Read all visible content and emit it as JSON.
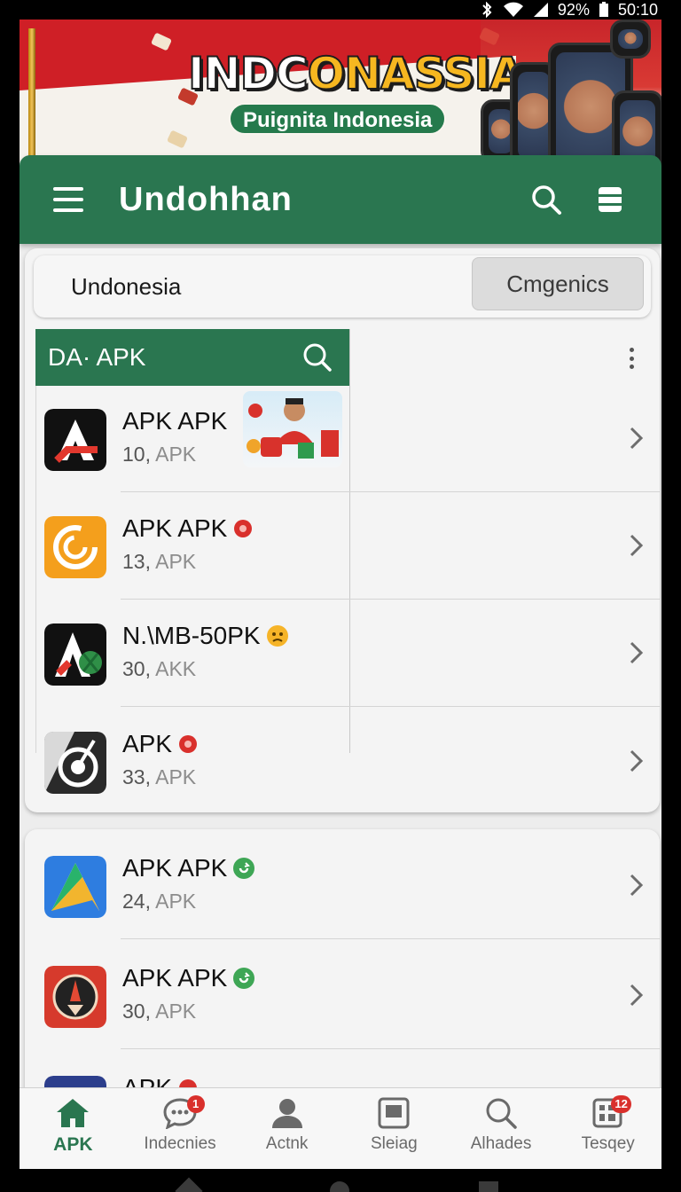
{
  "status_bar": {
    "battery": "92%",
    "time": "50:10"
  },
  "banner": {
    "title_part1": "INDC",
    "title_part2": "ONASSIA",
    "subtitle": "Puignita Indonesia"
  },
  "app_bar": {
    "title": "Undohhan"
  },
  "filter": {
    "label": "Undonesia",
    "button": "Cmgenics"
  },
  "sub_header": {
    "title": "DA· APK"
  },
  "card1_rows": [
    {
      "name": "APK APK",
      "count": "10,",
      "unit": "APK",
      "icon": "red-a-logo-icon",
      "badge": "balloon-icon"
    },
    {
      "name": "APK APK",
      "count": "13,",
      "unit": "APK",
      "icon": "orange-spiral-icon",
      "badge": "red-flower-icon"
    },
    {
      "name": "N.\\MB-50PK",
      "count": "30,",
      "unit": "AKK",
      "icon": "red-a-palm-icon",
      "badge": "angry-emoji-icon"
    },
    {
      "name": "APK",
      "count": "33,",
      "unit": "APK",
      "icon": "target-dial-icon",
      "badge": "red-flower-icon"
    }
  ],
  "card2_rows": [
    {
      "name": "APK APK",
      "count": "24,",
      "unit": "APK",
      "icon": "play-triangle-icon",
      "badge": "green-refresh-icon"
    },
    {
      "name": "APK APK",
      "count": "30,",
      "unit": "APK",
      "icon": "red-compass-icon",
      "badge": "green-refresh-icon"
    },
    {
      "name": "APK",
      "count": "",
      "unit": "",
      "icon": "blue-gear-icon",
      "badge": "red-flower-icon"
    }
  ],
  "bottom_nav": [
    {
      "label": "APK",
      "icon": "home-icon",
      "active": true,
      "badge": ""
    },
    {
      "label": "Indecnies",
      "icon": "chat-bubble-icon",
      "active": false,
      "badge": "1"
    },
    {
      "label": "Actnk",
      "icon": "person-icon",
      "active": false,
      "badge": ""
    },
    {
      "label": "Sleiag",
      "icon": "tablet-icon",
      "active": false,
      "badge": ""
    },
    {
      "label": "Alhades",
      "icon": "search-icon",
      "active": false,
      "badge": ""
    },
    {
      "label": "Tesqey",
      "icon": "grid-icon",
      "active": false,
      "badge": "12"
    }
  ],
  "colors": {
    "primary": "#2a7650",
    "badge": "#d9302c",
    "banner_red": "#cf1f26"
  }
}
